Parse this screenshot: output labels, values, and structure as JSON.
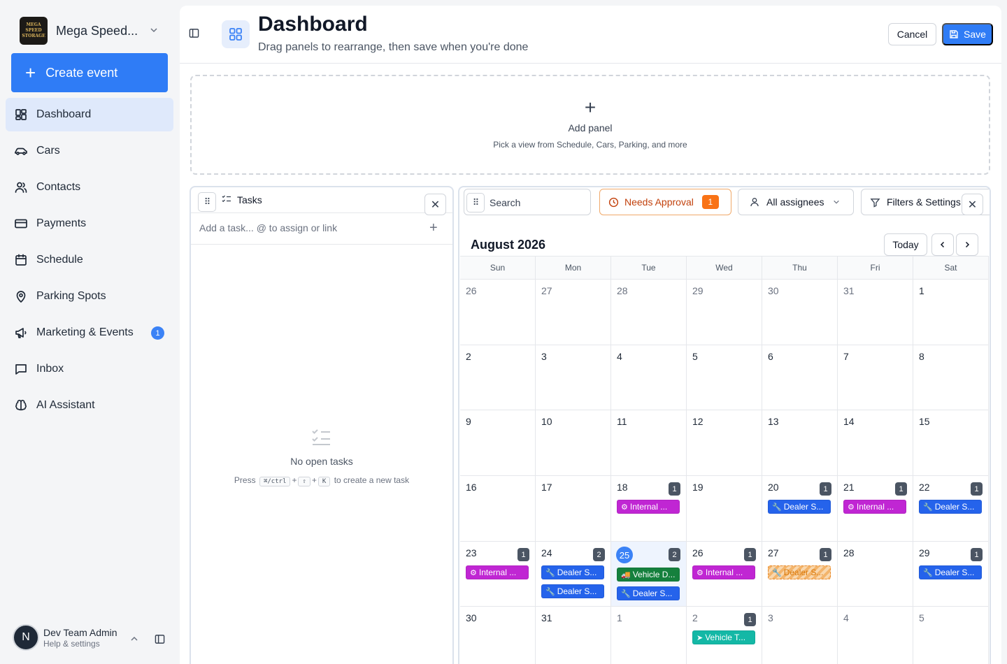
{
  "sidebar": {
    "brand_name": "Mega Speed...",
    "logo_text": [
      "MEGA SPEED",
      "STORAGE"
    ],
    "create_label": "Create event",
    "items": [
      {
        "label": "Dashboard",
        "icon": "dashboard-icon",
        "active": true
      },
      {
        "label": "Cars",
        "icon": "car-icon"
      },
      {
        "label": "Contacts",
        "icon": "contacts-icon"
      },
      {
        "label": "Payments",
        "icon": "credit-card-icon"
      },
      {
        "label": "Schedule",
        "icon": "calendar-icon"
      },
      {
        "label": "Parking Spots",
        "icon": "map-pin-icon"
      },
      {
        "label": "Marketing & Events",
        "icon": "megaphone-icon",
        "badge": "1"
      },
      {
        "label": "Inbox",
        "icon": "message-icon"
      },
      {
        "label": "AI Assistant",
        "icon": "brain-icon"
      }
    ],
    "user": {
      "initial": "N",
      "name": "Dev Team Admin",
      "sub": "Help & settings"
    }
  },
  "header": {
    "title": "Dashboard",
    "subtitle": "Drag panels to rearrange, then save when you're done",
    "cancel_label": "Cancel",
    "save_label": "Save"
  },
  "add_panel": {
    "title": "Add panel",
    "subtitle": "Pick a view from Schedule, Cars, Parking, and more"
  },
  "tasks": {
    "title": "Tasks",
    "placeholder": "Add a task... @ to assign or link",
    "empty_title": "No open tasks",
    "hint_press": "Press",
    "hint_keys": [
      "⌘/ctrl",
      "⇧",
      "K"
    ],
    "hint_suffix": "to create a new task"
  },
  "calendar": {
    "search_placeholder": "Search",
    "needs_approval_label": "Needs Approval",
    "needs_approval_count": "1",
    "assignees_label": "All assignees",
    "filters_label": "Filters & Settings",
    "month_label": "August 2026",
    "today_label": "Today",
    "days_of_week": [
      "Sun",
      "Mon",
      "Tue",
      "Wed",
      "Thu",
      "Fri",
      "Sat"
    ],
    "weeks": [
      [
        {
          "n": "26",
          "other": true
        },
        {
          "n": "27",
          "other": true
        },
        {
          "n": "28",
          "other": true
        },
        {
          "n": "29",
          "other": true
        },
        {
          "n": "30",
          "other": true
        },
        {
          "n": "31",
          "other": true
        },
        {
          "n": "1"
        }
      ],
      [
        {
          "n": "2"
        },
        {
          "n": "3"
        },
        {
          "n": "4"
        },
        {
          "n": "5"
        },
        {
          "n": "6"
        },
        {
          "n": "7"
        },
        {
          "n": "8"
        }
      ],
      [
        {
          "n": "9"
        },
        {
          "n": "10"
        },
        {
          "n": "11"
        },
        {
          "n": "12"
        },
        {
          "n": "13"
        },
        {
          "n": "14"
        },
        {
          "n": "15"
        }
      ],
      [
        {
          "n": "16"
        },
        {
          "n": "17"
        },
        {
          "n": "18",
          "count": "1",
          "events": [
            {
              "type": "internal",
              "label": "Internal ..."
            }
          ]
        },
        {
          "n": "19"
        },
        {
          "n": "20",
          "count": "1",
          "events": [
            {
              "type": "dealer",
              "label": "Dealer S..."
            }
          ]
        },
        {
          "n": "21",
          "count": "1",
          "events": [
            {
              "type": "internal",
              "label": "Internal ..."
            }
          ]
        },
        {
          "n": "22",
          "count": "1",
          "events": [
            {
              "type": "dealer",
              "label": "Dealer S..."
            }
          ]
        }
      ],
      [
        {
          "n": "23",
          "count": "1",
          "events": [
            {
              "type": "internal",
              "label": "Internal ..."
            }
          ]
        },
        {
          "n": "24",
          "count": "2",
          "events": [
            {
              "type": "dealer",
              "label": "Dealer S..."
            },
            {
              "type": "dealer",
              "label": "Dealer S..."
            }
          ]
        },
        {
          "n": "25",
          "count": "2",
          "today": true,
          "events": [
            {
              "type": "vehicle",
              "label": "Vehicle D..."
            },
            {
              "type": "dealer",
              "label": "Dealer S..."
            }
          ]
        },
        {
          "n": "26",
          "count": "1",
          "events": [
            {
              "type": "internal",
              "label": "Internal ..."
            }
          ]
        },
        {
          "n": "27",
          "count": "1",
          "events": [
            {
              "type": "pending",
              "label": "Dealer S..."
            }
          ]
        },
        {
          "n": "28"
        },
        {
          "n": "29",
          "count": "1",
          "events": [
            {
              "type": "dealer",
              "label": "Dealer S..."
            }
          ]
        }
      ],
      [
        {
          "n": "30"
        },
        {
          "n": "31"
        },
        {
          "n": "1",
          "other": true
        },
        {
          "n": "2",
          "other": true,
          "count": "1",
          "events": [
            {
              "type": "vteal",
              "label": "Vehicle T..."
            }
          ]
        },
        {
          "n": "3",
          "other": true
        },
        {
          "n": "4",
          "other": true
        },
        {
          "n": "5",
          "other": true
        }
      ]
    ]
  },
  "colors": {
    "accent": "#2f7cf6",
    "internal": "#c026d3",
    "dealer": "#2563eb",
    "vehicle": "#15803d",
    "vehicle_transport": "#14b8a6",
    "needs_approval": "#f97316"
  }
}
